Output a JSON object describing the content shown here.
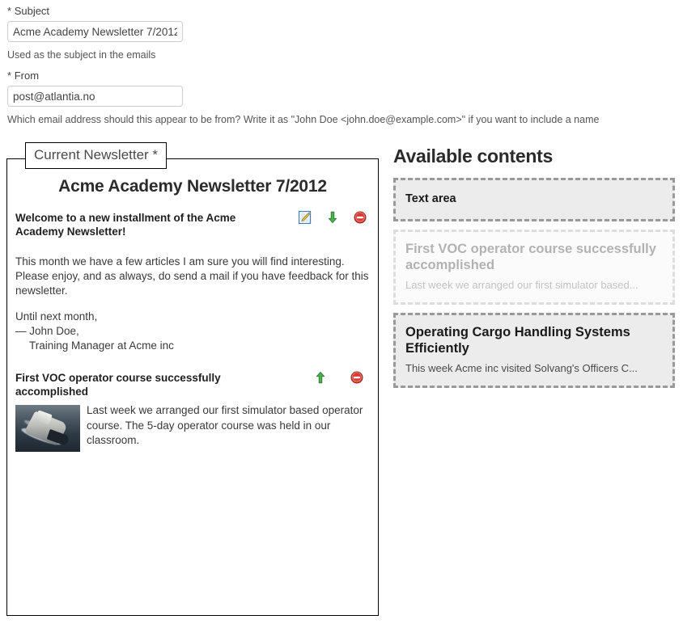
{
  "form": {
    "subject": {
      "label": "Subject",
      "required_marker": "*",
      "value": "Acme Academy Newsletter 7/2012",
      "help": "Used as the subject in the emails"
    },
    "from": {
      "label": "From",
      "required_marker": "*",
      "value": "post@atlantia.no",
      "help": "Which email address should this appear to be from? Write it as \"John Doe <john.doe@example.com>\" if you want to include a name"
    }
  },
  "newsletter": {
    "legend": "Current Newsletter *",
    "title": "Acme Academy Newsletter 7/2012",
    "blocks": [
      {
        "title": "Welcome to a new installment of the Acme Academy Newsletter!",
        "paragraphs": [
          "This month we have a few articles I am sure you will find interesting.",
          "Please enjoy, and as always, do send a mail if you have feedback for this newsletter."
        ],
        "signature_lead": "Until next month,",
        "signature_name": "— John Doe,",
        "signature_role": "Training Manager at Acme inc",
        "actions": [
          "edit-icon",
          "move-down-icon",
          "remove-icon"
        ]
      },
      {
        "title": "First VOC operator course successfully accomplished",
        "body": "Last week we arranged our first simulator based operator course. The 5-day operator course was held in our classroom.",
        "image_alt": "ship-photo",
        "actions": [
          "move-up-icon",
          "remove-icon"
        ]
      }
    ]
  },
  "available": {
    "heading": "Available contents",
    "items": [
      {
        "title": "Text area",
        "excerpt": "",
        "used": false
      },
      {
        "title": "First VOC operator course successfully accomplished",
        "excerpt": "Last week we arranged our first simulator based...",
        "used": true
      },
      {
        "title": "Operating Cargo Handling Systems Efficiently",
        "excerpt": "This week Acme inc visited Solvang's Officers C...",
        "used": false
      }
    ]
  },
  "colors": {
    "edit_icon": "#3b7fc4",
    "move_arrow": "#4caf50",
    "remove_icon": "#d93b32",
    "dashed_border": "#999999",
    "item_bg": "#ececec"
  }
}
